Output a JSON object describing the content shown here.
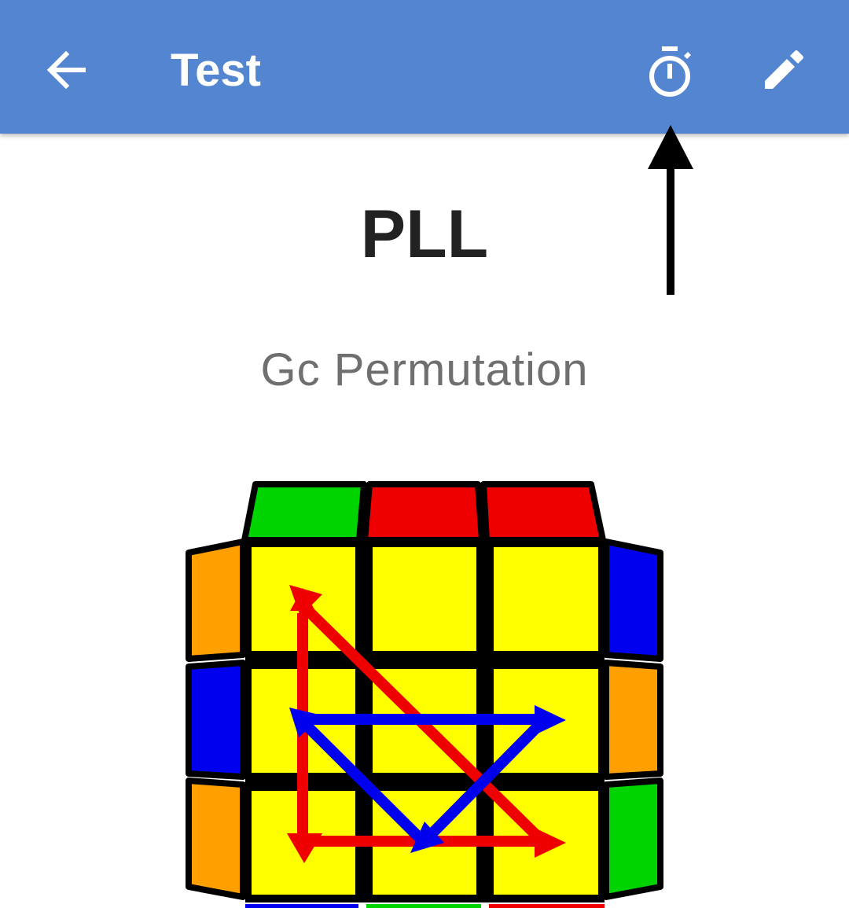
{
  "app_bar": {
    "title": "Test",
    "back_icon": "arrow-back-icon",
    "timer_icon": "stopwatch-icon",
    "edit_icon": "pencil-icon",
    "background_color": "#5485d0"
  },
  "case": {
    "set_name": "PLL",
    "case_name": "Gc Permutation"
  },
  "cube_diagram": {
    "top_face_color": "yellow",
    "top_edge_colors": [
      "green",
      "red",
      "red"
    ],
    "left_edge_colors": [
      "orange",
      "blue",
      "orange"
    ],
    "right_edge_colors": [
      "blue",
      "orange",
      "green"
    ],
    "bottom_edge_colors": [
      "blue",
      "green",
      "red"
    ],
    "arrow_colors": [
      "#ee0000",
      "#0000ee"
    ]
  }
}
